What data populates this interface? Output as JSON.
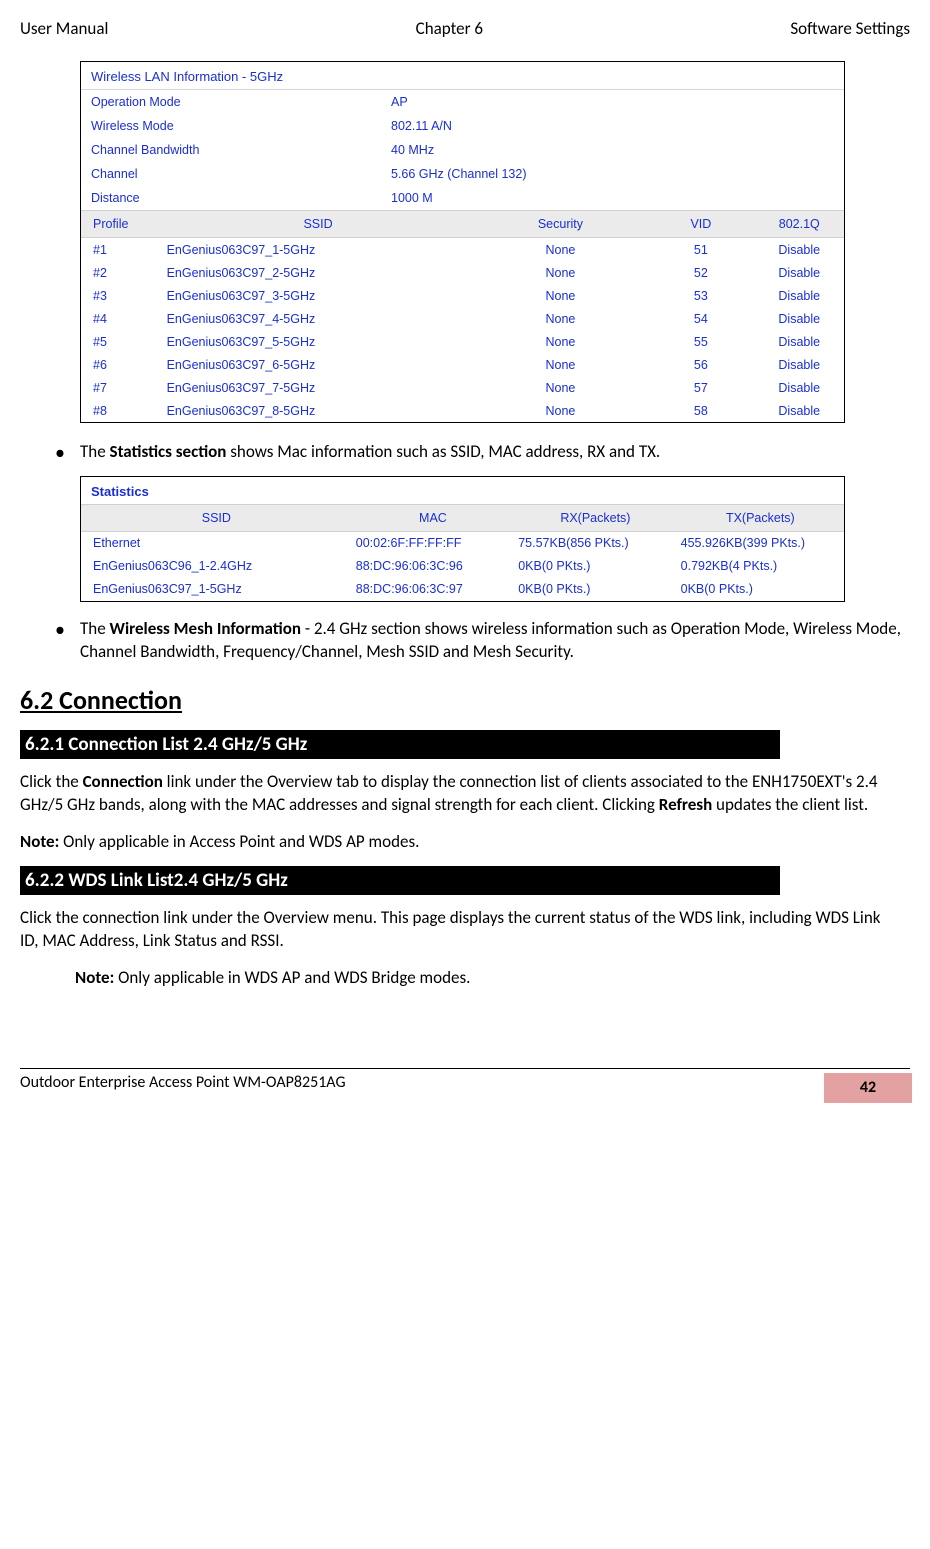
{
  "header": {
    "left": "User Manual",
    "center": "Chapter 6",
    "right": "Software Settings"
  },
  "wlan": {
    "title": "Wireless LAN Information - 5GHz",
    "rows": [
      {
        "label": "Operation Mode",
        "value": "AP"
      },
      {
        "label": "Wireless Mode",
        "value": "802.11 A/N"
      },
      {
        "label": "Channel Bandwidth",
        "value": "40 MHz"
      },
      {
        "label": "Channel",
        "value": "5.66 GHz (Channel 132)"
      },
      {
        "label": "Distance",
        "value": "1000 M"
      }
    ],
    "subhead": {
      "profile": "Profile",
      "ssid": "SSID",
      "sec": "Security",
      "vid": "VID",
      "q": "802.1Q"
    },
    "profiles": [
      {
        "p": "#1",
        "ssid": "EnGenius063C97_1-5GHz",
        "sec": "None",
        "vid": "51",
        "q": "Disable"
      },
      {
        "p": "#2",
        "ssid": "EnGenius063C97_2-5GHz",
        "sec": "None",
        "vid": "52",
        "q": "Disable"
      },
      {
        "p": "#3",
        "ssid": "EnGenius063C97_3-5GHz",
        "sec": "None",
        "vid": "53",
        "q": "Disable"
      },
      {
        "p": "#4",
        "ssid": "EnGenius063C97_4-5GHz",
        "sec": "None",
        "vid": "54",
        "q": "Disable"
      },
      {
        "p": "#5",
        "ssid": "EnGenius063C97_5-5GHz",
        "sec": "None",
        "vid": "55",
        "q": "Disable"
      },
      {
        "p": "#6",
        "ssid": "EnGenius063C97_6-5GHz",
        "sec": "None",
        "vid": "56",
        "q": "Disable"
      },
      {
        "p": "#7",
        "ssid": "EnGenius063C97_7-5GHz",
        "sec": "None",
        "vid": "57",
        "q": "Disable"
      },
      {
        "p": "#8",
        "ssid": "EnGenius063C97_8-5GHz",
        "sec": "None",
        "vid": "58",
        "q": "Disable"
      }
    ]
  },
  "bullet1": {
    "pre": "The ",
    "bold": "Statistics section",
    "post": " shows Mac information such as SSID, MAC address, RX and TX."
  },
  "stats": {
    "title": "Statistics",
    "subhead": {
      "ssid": "SSID",
      "mac": "MAC",
      "rx": "RX(Packets)",
      "tx": "TX(Packets)"
    },
    "rows": [
      {
        "ssid": "Ethernet",
        "mac": "00:02:6F:FF:FF:FF",
        "rx": "75.57KB(856 PKts.)",
        "tx": "455.926KB(399 PKts.)"
      },
      {
        "ssid": "EnGenius063C96_1-2.4GHz",
        "mac": "88:DC:96:06:3C:96",
        "rx": "0KB(0 PKts.)",
        "tx": "0.792KB(4 PKts.)"
      },
      {
        "ssid": "EnGenius063C97_1-5GHz",
        "mac": "88:DC:96:06:3C:97",
        "rx": "0KB(0 PKts.)",
        "tx": "0KB(0 PKts.)"
      }
    ]
  },
  "bullet2": {
    "pre": "The ",
    "bold": "Wireless Mesh Information",
    "post": " - 2.4 GHz section shows wireless information such as Operation Mode, Wireless Mode, Channel Bandwidth, Frequency/Channel, Mesh SSID and Mesh Security."
  },
  "h62": "6.2 Connection",
  "h621": "6.2.1 Connection List 2.4 GHz/5 GHz",
  "para1": {
    "a": "Click the ",
    "b": "Connection",
    "c": " link under the Overview tab to display the connection list of clients associated to the ENH1750EXT's 2.4 GHz/5 GHz bands, along with the MAC addresses and signal strength for each client. Clicking ",
    "d": "Refresh",
    "e": " updates the client list."
  },
  "note1": {
    "a": "Note:",
    "b": " Only applicable in Access Point and WDS AP modes."
  },
  "h622": "6.2.2  WDS Link List2.4 GHz/5 GHz",
  "para2": "Click the connection link under the Overview menu. This page displays the current status of the WDS link, including WDS Link ID, MAC Address, Link Status and RSSI.",
  "note2": {
    "a": "Note:",
    "b": " Only applicable in WDS AP and WDS Bridge modes."
  },
  "footer": {
    "left": "Outdoor Enterprise Access Point WM-OAP8251AG",
    "page": "42"
  }
}
